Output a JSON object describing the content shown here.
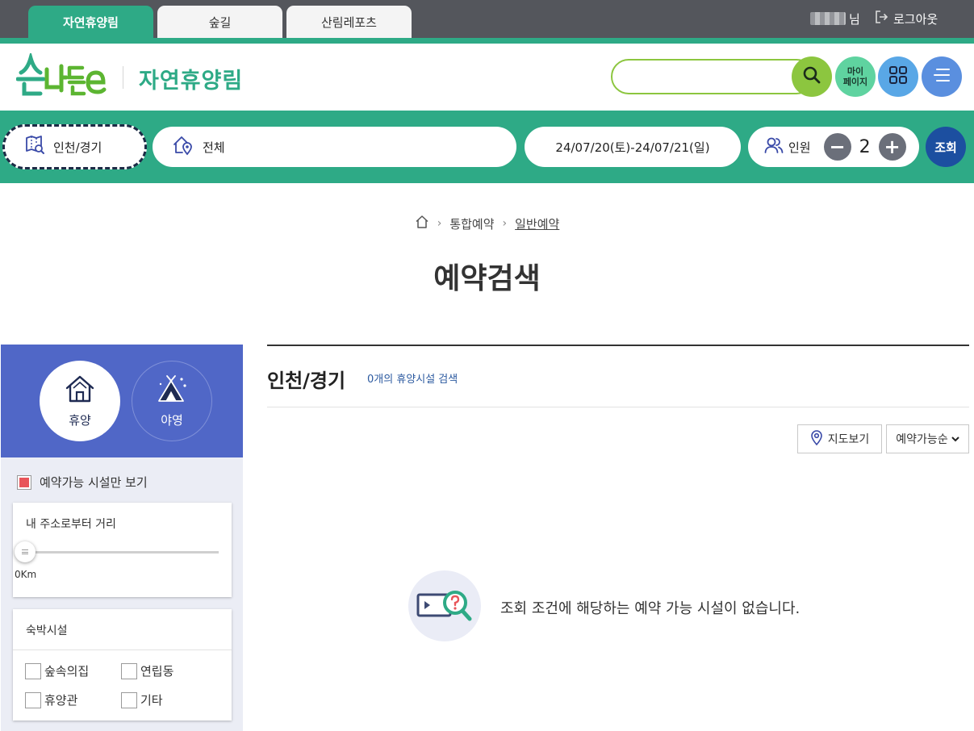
{
  "top_tabs": [
    {
      "label": "자연휴양림",
      "active": true
    },
    {
      "label": "숲길",
      "active": false
    },
    {
      "label": "산림레포츠",
      "active": false
    }
  ],
  "user": {
    "suffix": "님",
    "logout_label": "로그아웃"
  },
  "header": {
    "logo_alt": "숲나들e",
    "site_title": "자연휴양림",
    "search_placeholder": "",
    "mypage_line1": "마이",
    "mypage_line2": "페이지"
  },
  "filter": {
    "region": "인천/경기",
    "area": "전체",
    "date_range": "24/07/20(토)-24/07/21(일)",
    "people_label": "인원",
    "people_count": "2",
    "minus": "−",
    "plus": "+",
    "lookup_label": "조회"
  },
  "breadcrumb": {
    "item1": "통합예약",
    "item2": "일반예약",
    "sep": "›"
  },
  "page_title": "예약검색",
  "sidebar": {
    "types": [
      {
        "label": "휴양",
        "selected": true
      },
      {
        "label": "야영",
        "selected": false
      }
    ],
    "available_only_label": "예약가능 시설만 보기",
    "distance": {
      "title": "내 주소로부터 거리",
      "value": "0Km",
      "level": 0
    },
    "lodging": {
      "title": "숙박시설",
      "options": [
        "숲속의집",
        "연립동",
        "휴양관",
        "기타"
      ]
    }
  },
  "results": {
    "region_title": "인천/경기",
    "count_text": "0개의 휴양시설 검색",
    "map_button": "지도보기",
    "sort_label": "예약가능순",
    "empty_message": "조회 조건에 해당하는 예약 가능 시설이 없습니다."
  },
  "colors": {
    "brand_green": "#2eaa86",
    "lime": "#8cc63f",
    "sidebar_blue": "#5067c7",
    "lookup_navy": "#1c4fa0",
    "check_red": "#e8555a"
  }
}
